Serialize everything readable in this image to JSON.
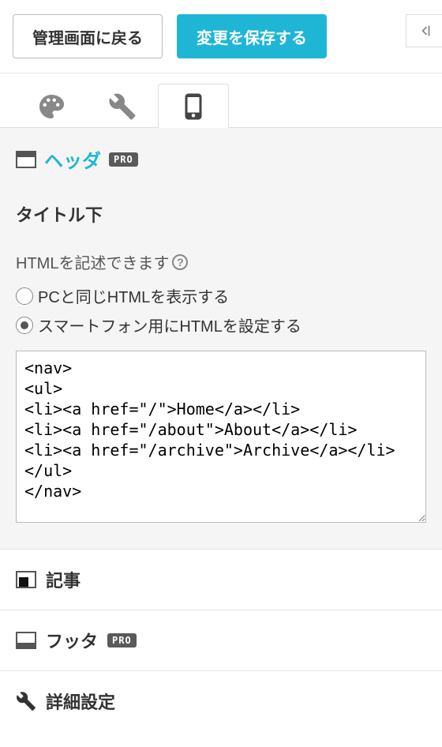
{
  "topbar": {
    "back_label": "管理画面に戻る",
    "save_label": "変更を保存する"
  },
  "tabs": {
    "items": [
      {
        "name": "design",
        "icon": "palette"
      },
      {
        "name": "tools",
        "icon": "wrench"
      },
      {
        "name": "mobile",
        "icon": "phone"
      }
    ],
    "active": "mobile"
  },
  "header_panel": {
    "title": "ヘッダ",
    "pro_badge": "PRO"
  },
  "section": {
    "subtitle": "タイトル下",
    "help_text": "HTMLを記述できます",
    "radios": {
      "same_as_pc": "PCと同じHTMLを表示する",
      "smartphone_custom": "スマートフォン用にHTMLを設定する",
      "selected": "smartphone_custom"
    },
    "html_value": "<nav>\n<ul>\n<li><a href=\"/\">Home</a></li>\n<li><a href=\"/about\">About</a></li>\n<li><a href=\"/archive\">Archive</a></li>\n</ul>\n</nav>"
  },
  "collapsed_sections": {
    "article": {
      "label": "記事"
    },
    "footer": {
      "label": "フッタ",
      "pro_badge": "PRO"
    },
    "advanced": {
      "label": "詳細設定"
    }
  }
}
